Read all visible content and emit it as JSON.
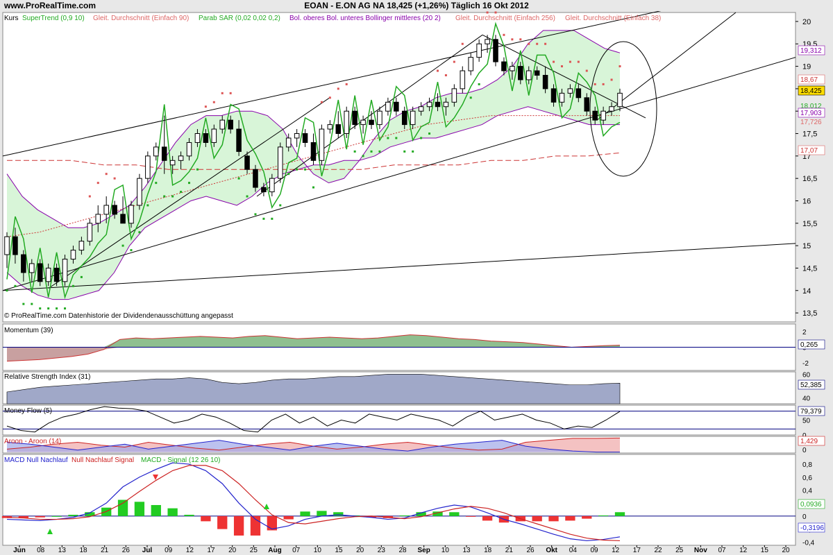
{
  "header": {
    "site": "www.ProRealTime.com",
    "instrument": "EOAN - E.ON AG NA   18,425 (+1,26%)   Täglich  16 Okt 2012"
  },
  "colors": {
    "panel_bg": "#ffffff",
    "bb_fill": "#d8f5d8",
    "bb_line": "#8800aa",
    "supertrend_up": "#22aa22",
    "supertrend_down": "#cc2222",
    "sar": "#dd5555",
    "sar_up": "#22aa22",
    "ma90": "#cc3333",
    "ma256": "#cc3333",
    "ma38": "#dd6666",
    "trendline": "#000000",
    "momentum_pos": "#8fbf8f",
    "momentum_neg": "#c8a0a0",
    "rsi_fill": "#a0a8c8",
    "aroon_up": "#cc2222",
    "aroon_down": "#2222cc",
    "macd_up": "#22cc22",
    "macd_down": "#ee3333"
  },
  "legend": {
    "kurs": "Kurs",
    "supertrend": "SuperTrend (0,9 10)",
    "ma90": "Gleit. Durchschnitt (Einfach 90)",
    "sar": "Parab SAR (0,02 0,02 0,2)",
    "bollinger": "Bol. oberes Bol. unteres Bollinger mittleres (20 2)",
    "ma256": "Gleit. Durchschnitt (Einfach 256)",
    "ma38": "Gleit. Durchschnitt (Einfach 38)"
  },
  "copyright": "© ProRealTime.com  Datenhistorie der Dividendenausschüttung angepasst",
  "price_labels": {
    "bb_upper": "19,312",
    "ma38": "18,67",
    "last": "18,425",
    "bb_mid": "18,012",
    "ma90": "17,903",
    "sar_v": "17,726",
    "ma256": "17,07"
  },
  "panels": {
    "momentum": {
      "title": "Momentum (39)",
      "value": "0,265"
    },
    "rsi": {
      "title": "Relative Strength Index (31)",
      "value": "52,385"
    },
    "moneyflow": {
      "title": "Money Flow (5)",
      "value": "79,379"
    },
    "aroon": {
      "title": "Aroon - Aroon (14)",
      "value": "1,429",
      "value2": "0"
    },
    "macd": {
      "title_a": "MACD Null Nachlauf",
      "title_b": "Null Nachlauf Signal",
      "title_c": "MACD - Signal (12 26 10)",
      "value": "0,0936",
      "value2": "-0,3196"
    }
  },
  "chart_data": [
    {
      "type": "candlestick",
      "title": "EOAN - E.ON AG NA",
      "x_labels": [
        "Jun",
        "08",
        "13",
        "18",
        "21",
        "26",
        "Jul",
        "09",
        "12",
        "17",
        "20",
        "25",
        "Aug",
        "07",
        "10",
        "15",
        "20",
        "23",
        "28",
        "Sep",
        "10",
        "13",
        "18",
        "21",
        "26",
        "Okt",
        "04",
        "09",
        "12",
        "17",
        "22",
        "25",
        "Nov",
        "07",
        "12",
        "15",
        "20"
      ],
      "ylim": [
        13.3,
        20.2
      ],
      "yticks": [
        13.5,
        14,
        14.5,
        15,
        15.5,
        16,
        16.5,
        17,
        17.5,
        18,
        18.5,
        19,
        19.5,
        20
      ],
      "candles": [
        {
          "o": 14.8,
          "h": 15.3,
          "l": 14.5,
          "c": 15.2
        },
        {
          "o": 15.2,
          "h": 15.4,
          "l": 14.6,
          "c": 14.8
        },
        {
          "o": 14.8,
          "h": 14.9,
          "l": 14.2,
          "c": 14.4
        },
        {
          "o": 14.4,
          "h": 14.7,
          "l": 14.2,
          "c": 14.6
        },
        {
          "o": 14.6,
          "h": 14.7,
          "l": 14.1,
          "c": 14.2
        },
        {
          "o": 14.2,
          "h": 14.6,
          "l": 14.1,
          "c": 14.5
        },
        {
          "o": 14.5,
          "h": 14.6,
          "l": 14.1,
          "c": 14.2
        },
        {
          "o": 14.2,
          "h": 14.8,
          "l": 14.1,
          "c": 14.7
        },
        {
          "o": 14.7,
          "h": 15.0,
          "l": 14.6,
          "c": 14.9
        },
        {
          "o": 14.9,
          "h": 15.2,
          "l": 14.8,
          "c": 15.1
        },
        {
          "o": 15.1,
          "h": 15.6,
          "l": 15.0,
          "c": 15.5
        },
        {
          "o": 15.5,
          "h": 15.9,
          "l": 15.3,
          "c": 15.7
        },
        {
          "o": 15.7,
          "h": 16.1,
          "l": 15.5,
          "c": 15.9
        },
        {
          "o": 15.9,
          "h": 16.0,
          "l": 15.6,
          "c": 15.7
        },
        {
          "o": 15.7,
          "h": 16.1,
          "l": 15.5,
          "c": 15.5
        },
        {
          "o": 15.5,
          "h": 16.0,
          "l": 15.4,
          "c": 15.9
        },
        {
          "o": 15.9,
          "h": 16.6,
          "l": 15.8,
          "c": 16.5
        },
        {
          "o": 16.5,
          "h": 17.1,
          "l": 16.4,
          "c": 17.0
        },
        {
          "o": 17.0,
          "h": 17.3,
          "l": 16.9,
          "c": 17.2
        },
        {
          "o": 17.2,
          "h": 17.9,
          "l": 16.6,
          "c": 16.9
        },
        {
          "o": 16.8,
          "h": 17.0,
          "l": 16.6,
          "c": 16.9
        },
        {
          "o": 16.9,
          "h": 17.1,
          "l": 16.7,
          "c": 17.0
        },
        {
          "o": 17.0,
          "h": 17.4,
          "l": 16.9,
          "c": 17.3
        },
        {
          "o": 17.3,
          "h": 17.6,
          "l": 17.2,
          "c": 17.5
        },
        {
          "o": 17.5,
          "h": 17.6,
          "l": 17.2,
          "c": 17.3
        },
        {
          "o": 17.3,
          "h": 17.7,
          "l": 17.2,
          "c": 17.6
        },
        {
          "o": 17.6,
          "h": 17.9,
          "l": 17.5,
          "c": 17.8
        },
        {
          "o": 17.8,
          "h": 17.9,
          "l": 17.5,
          "c": 17.6
        },
        {
          "o": 17.6,
          "h": 17.8,
          "l": 17.0,
          "c": 17.1
        },
        {
          "o": 17.0,
          "h": 17.1,
          "l": 16.6,
          "c": 16.7
        },
        {
          "o": 16.7,
          "h": 16.8,
          "l": 16.2,
          "c": 16.3
        },
        {
          "o": 16.3,
          "h": 16.4,
          "l": 16.1,
          "c": 16.2
        },
        {
          "o": 16.2,
          "h": 16.6,
          "l": 16.1,
          "c": 16.5
        },
        {
          "o": 16.5,
          "h": 17.3,
          "l": 16.4,
          "c": 17.2
        },
        {
          "o": 17.2,
          "h": 17.5,
          "l": 17.1,
          "c": 17.4
        },
        {
          "o": 17.4,
          "h": 17.6,
          "l": 17.2,
          "c": 17.5
        },
        {
          "o": 17.5,
          "h": 17.6,
          "l": 17.2,
          "c": 17.3
        },
        {
          "o": 17.3,
          "h": 17.5,
          "l": 16.8,
          "c": 16.9
        },
        {
          "o": 16.9,
          "h": 17.7,
          "l": 16.8,
          "c": 17.6
        },
        {
          "o": 17.6,
          "h": 17.8,
          "l": 17.5,
          "c": 17.7
        },
        {
          "o": 17.7,
          "h": 18.0,
          "l": 17.4,
          "c": 17.5
        },
        {
          "o": 17.5,
          "h": 18.1,
          "l": 17.4,
          "c": 18.0
        },
        {
          "o": 18.0,
          "h": 18.1,
          "l": 17.6,
          "c": 17.7
        },
        {
          "o": 17.7,
          "h": 17.9,
          "l": 17.5,
          "c": 17.8
        },
        {
          "o": 17.8,
          "h": 18.0,
          "l": 17.6,
          "c": 17.7
        },
        {
          "o": 17.7,
          "h": 18.1,
          "l": 17.6,
          "c": 18.0
        },
        {
          "o": 18.0,
          "h": 18.3,
          "l": 17.9,
          "c": 18.2
        },
        {
          "o": 18.2,
          "h": 18.3,
          "l": 17.9,
          "c": 18.0
        },
        {
          "o": 18.0,
          "h": 18.1,
          "l": 17.6,
          "c": 17.7
        },
        {
          "o": 17.7,
          "h": 18.1,
          "l": 17.6,
          "c": 18.0
        },
        {
          "o": 18.0,
          "h": 18.2,
          "l": 17.9,
          "c": 18.1
        },
        {
          "o": 18.1,
          "h": 18.3,
          "l": 18.0,
          "c": 18.2
        },
        {
          "o": 18.2,
          "h": 18.4,
          "l": 18.0,
          "c": 18.1
        },
        {
          "o": 18.1,
          "h": 18.3,
          "l": 17.9,
          "c": 18.2
        },
        {
          "o": 18.2,
          "h": 18.6,
          "l": 18.1,
          "c": 18.5
        },
        {
          "o": 18.5,
          "h": 19.0,
          "l": 18.4,
          "c": 18.9
        },
        {
          "o": 18.9,
          "h": 19.3,
          "l": 18.8,
          "c": 19.2
        },
        {
          "o": 19.2,
          "h": 19.6,
          "l": 19.1,
          "c": 19.5
        },
        {
          "o": 19.5,
          "h": 19.7,
          "l": 19.3,
          "c": 19.6
        },
        {
          "o": 19.6,
          "h": 19.7,
          "l": 19.0,
          "c": 19.1
        },
        {
          "o": 19.1,
          "h": 19.2,
          "l": 18.8,
          "c": 18.9
        },
        {
          "o": 18.9,
          "h": 19.1,
          "l": 18.7,
          "c": 19.0
        },
        {
          "o": 19.0,
          "h": 19.1,
          "l": 18.6,
          "c": 18.7
        },
        {
          "o": 18.7,
          "h": 19.0,
          "l": 18.6,
          "c": 18.9
        },
        {
          "o": 18.9,
          "h": 19.0,
          "l": 18.7,
          "c": 18.8
        },
        {
          "o": 18.8,
          "h": 19.0,
          "l": 18.4,
          "c": 18.5
        },
        {
          "o": 18.5,
          "h": 18.6,
          "l": 18.1,
          "c": 18.2
        },
        {
          "o": 18.2,
          "h": 18.5,
          "l": 18.1,
          "c": 18.4
        },
        {
          "o": 18.4,
          "h": 18.6,
          "l": 18.3,
          "c": 18.5
        },
        {
          "o": 18.5,
          "h": 18.6,
          "l": 18.2,
          "c": 18.3
        },
        {
          "o": 18.3,
          "h": 18.4,
          "l": 17.9,
          "c": 18.0
        },
        {
          "o": 18.0,
          "h": 18.1,
          "l": 17.7,
          "c": 17.8
        },
        {
          "o": 17.8,
          "h": 18.1,
          "l": 17.7,
          "c": 18.0
        },
        {
          "o": 18.0,
          "h": 18.2,
          "l": 17.9,
          "c": 18.1
        },
        {
          "o": 18.1,
          "h": 18.5,
          "l": 18.0,
          "c": 18.4
        }
      ],
      "bb_upper": [
        16.6,
        16.1,
        15.8,
        15.6,
        15.4,
        15.4,
        15.5,
        15.7,
        15.9,
        16.3,
        16.8,
        17.3,
        17.7,
        17.9,
        17.9,
        18.0,
        18.0,
        17.9,
        17.6,
        17.0,
        16.6,
        16.4,
        16.5,
        16.9,
        17.4,
        17.8,
        18.0,
        18.1,
        18.3,
        18.4,
        18.4,
        18.5,
        18.7,
        19.0,
        19.5,
        19.8,
        19.8,
        19.8,
        19.6,
        19.4,
        19.3
      ],
      "bb_lower": [
        14.4,
        14.1,
        13.9,
        13.8,
        13.8,
        13.9,
        14.0,
        14.4,
        15.0,
        15.4,
        15.6,
        15.8,
        16.0,
        16.1,
        16.0,
        15.9,
        16.1,
        16.4,
        16.6,
        16.7,
        16.8,
        16.8,
        16.9,
        16.9,
        17.0,
        17.2,
        17.3,
        17.4,
        17.4,
        17.5,
        17.6,
        17.7,
        17.9,
        18.0,
        18.1,
        18.0,
        17.9,
        17.8,
        17.7,
        17.7,
        17.7
      ],
      "ma256": [
        16.9,
        16.9,
        16.9,
        16.8,
        16.8,
        16.7,
        16.7,
        16.7,
        16.7,
        16.7,
        16.7,
        16.7,
        16.8,
        16.8,
        16.8,
        16.9,
        16.9,
        17.0,
        17.0,
        17.07
      ],
      "ma90": [
        15.2,
        15.3,
        15.5,
        15.7,
        15.9,
        16.1,
        16.3,
        16.5,
        16.7,
        16.9,
        17.1,
        17.3,
        17.5,
        17.7,
        17.8,
        17.9,
        17.9,
        17.9,
        17.9,
        17.9
      ],
      "trendline_channel": {
        "a_start": 17.0,
        "a_end": 20.2,
        "b_start": 14.0,
        "b_end": 18.6
      },
      "trendline_low": {
        "start": 14.0,
        "end": 15.05
      }
    },
    {
      "type": "area",
      "name": "Momentum (39)",
      "ylim": [
        -3,
        3
      ],
      "yticks": [
        2,
        0,
        -2
      ],
      "values": [
        -1.8,
        -1.7,
        -1.6,
        -1.4,
        -1.2,
        -0.9,
        -0.3,
        1.0,
        1.2,
        1.1,
        1.2,
        1.3,
        1.4,
        1.3,
        1.2,
        1.4,
        1.5,
        1.3,
        1.1,
        1.2,
        1.3,
        1.2,
        1.1,
        1.2,
        1.4,
        1.6,
        1.5,
        1.3,
        1.1,
        1.0,
        0.8,
        0.7,
        0.6,
        0.4,
        0.2,
        0.0,
        0.1,
        0.2,
        0.265
      ]
    },
    {
      "type": "area",
      "name": "Relative Strength Index (31)",
      "ylim": [
        35,
        62
      ],
      "yticks": [
        60,
        50,
        40
      ],
      "values": [
        45,
        47,
        49,
        50,
        51,
        52,
        53,
        54,
        55,
        56,
        56,
        57,
        56,
        53,
        52,
        53,
        55,
        56,
        56,
        57,
        58,
        58,
        59,
        60,
        60,
        60,
        59,
        58,
        57,
        56,
        55,
        54,
        53,
        52,
        51,
        51,
        52,
        52.4
      ]
    },
    {
      "type": "line",
      "name": "Money Flow (5)",
      "ylim": [
        0,
        100
      ],
      "yticks": [
        50,
        0
      ],
      "values": [
        30,
        15,
        10,
        40,
        60,
        70,
        85,
        95,
        90,
        88,
        80,
        60,
        40,
        50,
        70,
        60,
        40,
        15,
        10,
        50,
        70,
        40,
        60,
        30,
        50,
        40,
        70,
        60,
        50,
        70,
        60,
        50,
        30,
        60,
        80,
        50,
        60,
        70,
        50,
        40,
        20,
        30,
        25,
        50,
        79
      ]
    },
    {
      "type": "line",
      "name": "Aroon (14)",
      "ylim": [
        -0.1,
        1.6
      ],
      "yticks": [
        1,
        0
      ],
      "up": [
        0.3,
        0.5,
        0.8,
        1.0,
        0.7,
        0.5,
        1.0,
        0.7,
        0.4,
        0.2,
        0.5,
        0.8,
        1.0,
        0.6,
        0.3,
        0.5,
        0.8,
        1.0,
        0.7,
        0.4,
        0.2,
        0.3,
        1.0,
        1.2,
        1.4,
        1.4,
        1.43
      ],
      "down": [
        1.0,
        0.8,
        0.5,
        0.2,
        0.5,
        0.8,
        0.3,
        0.6,
        0.9,
        1.2,
        0.8,
        0.5,
        0.2,
        0.6,
        0.9,
        0.6,
        0.3,
        0.1,
        0.5,
        0.8,
        1.0,
        1.2,
        0.6,
        0.3,
        0.1,
        0.0,
        0.0
      ]
    },
    {
      "type": "bar",
      "name": "MACD - Signal (12 26 10)",
      "ylim": [
        -0.45,
        0.95
      ],
      "yticks": [
        0.8,
        0.6,
        0.4,
        0.2,
        0,
        -0.2,
        -0.4
      ],
      "macd": [
        -0.05,
        -0.06,
        -0.07,
        -0.05,
        -0.02,
        0.05,
        0.2,
        0.45,
        0.6,
        0.72,
        0.82,
        0.8,
        0.7,
        0.5,
        0.2,
        -0.05,
        -0.2,
        -0.15,
        -0.05,
        0.0,
        0.02,
        0.0,
        -0.02,
        -0.05,
        -0.03,
        0.05,
        0.12,
        0.17,
        0.14,
        0.05,
        -0.05,
        -0.12,
        -0.2,
        -0.28,
        -0.35,
        -0.38,
        -0.36,
        -0.32
      ],
      "signal": [
        -0.02,
        -0.03,
        -0.05,
        -0.05,
        -0.04,
        -0.01,
        0.07,
        0.2,
        0.38,
        0.55,
        0.7,
        0.78,
        0.78,
        0.7,
        0.5,
        0.25,
        0.02,
        -0.1,
        -0.12,
        -0.08,
        -0.04,
        -0.01,
        0.0,
        -0.02,
        -0.04,
        -0.01,
        0.05,
        0.11,
        0.15,
        0.12,
        0.05,
        -0.04,
        -0.12,
        -0.2,
        -0.28,
        -0.34,
        -0.37,
        -0.38
      ],
      "histogram": [
        -0.03,
        -0.03,
        -0.02,
        0.0,
        0.02,
        0.06,
        0.13,
        0.25,
        0.22,
        0.17,
        0.12,
        0.02,
        -0.08,
        -0.2,
        -0.3,
        -0.3,
        -0.22,
        -0.05,
        0.07,
        0.08,
        0.06,
        0.01,
        -0.02,
        -0.03,
        0.01,
        0.06,
        0.07,
        0.06,
        -0.01,
        -0.07,
        -0.1,
        -0.08,
        -0.08,
        -0.08,
        -0.07,
        -0.04,
        0.01,
        0.06
      ]
    }
  ]
}
